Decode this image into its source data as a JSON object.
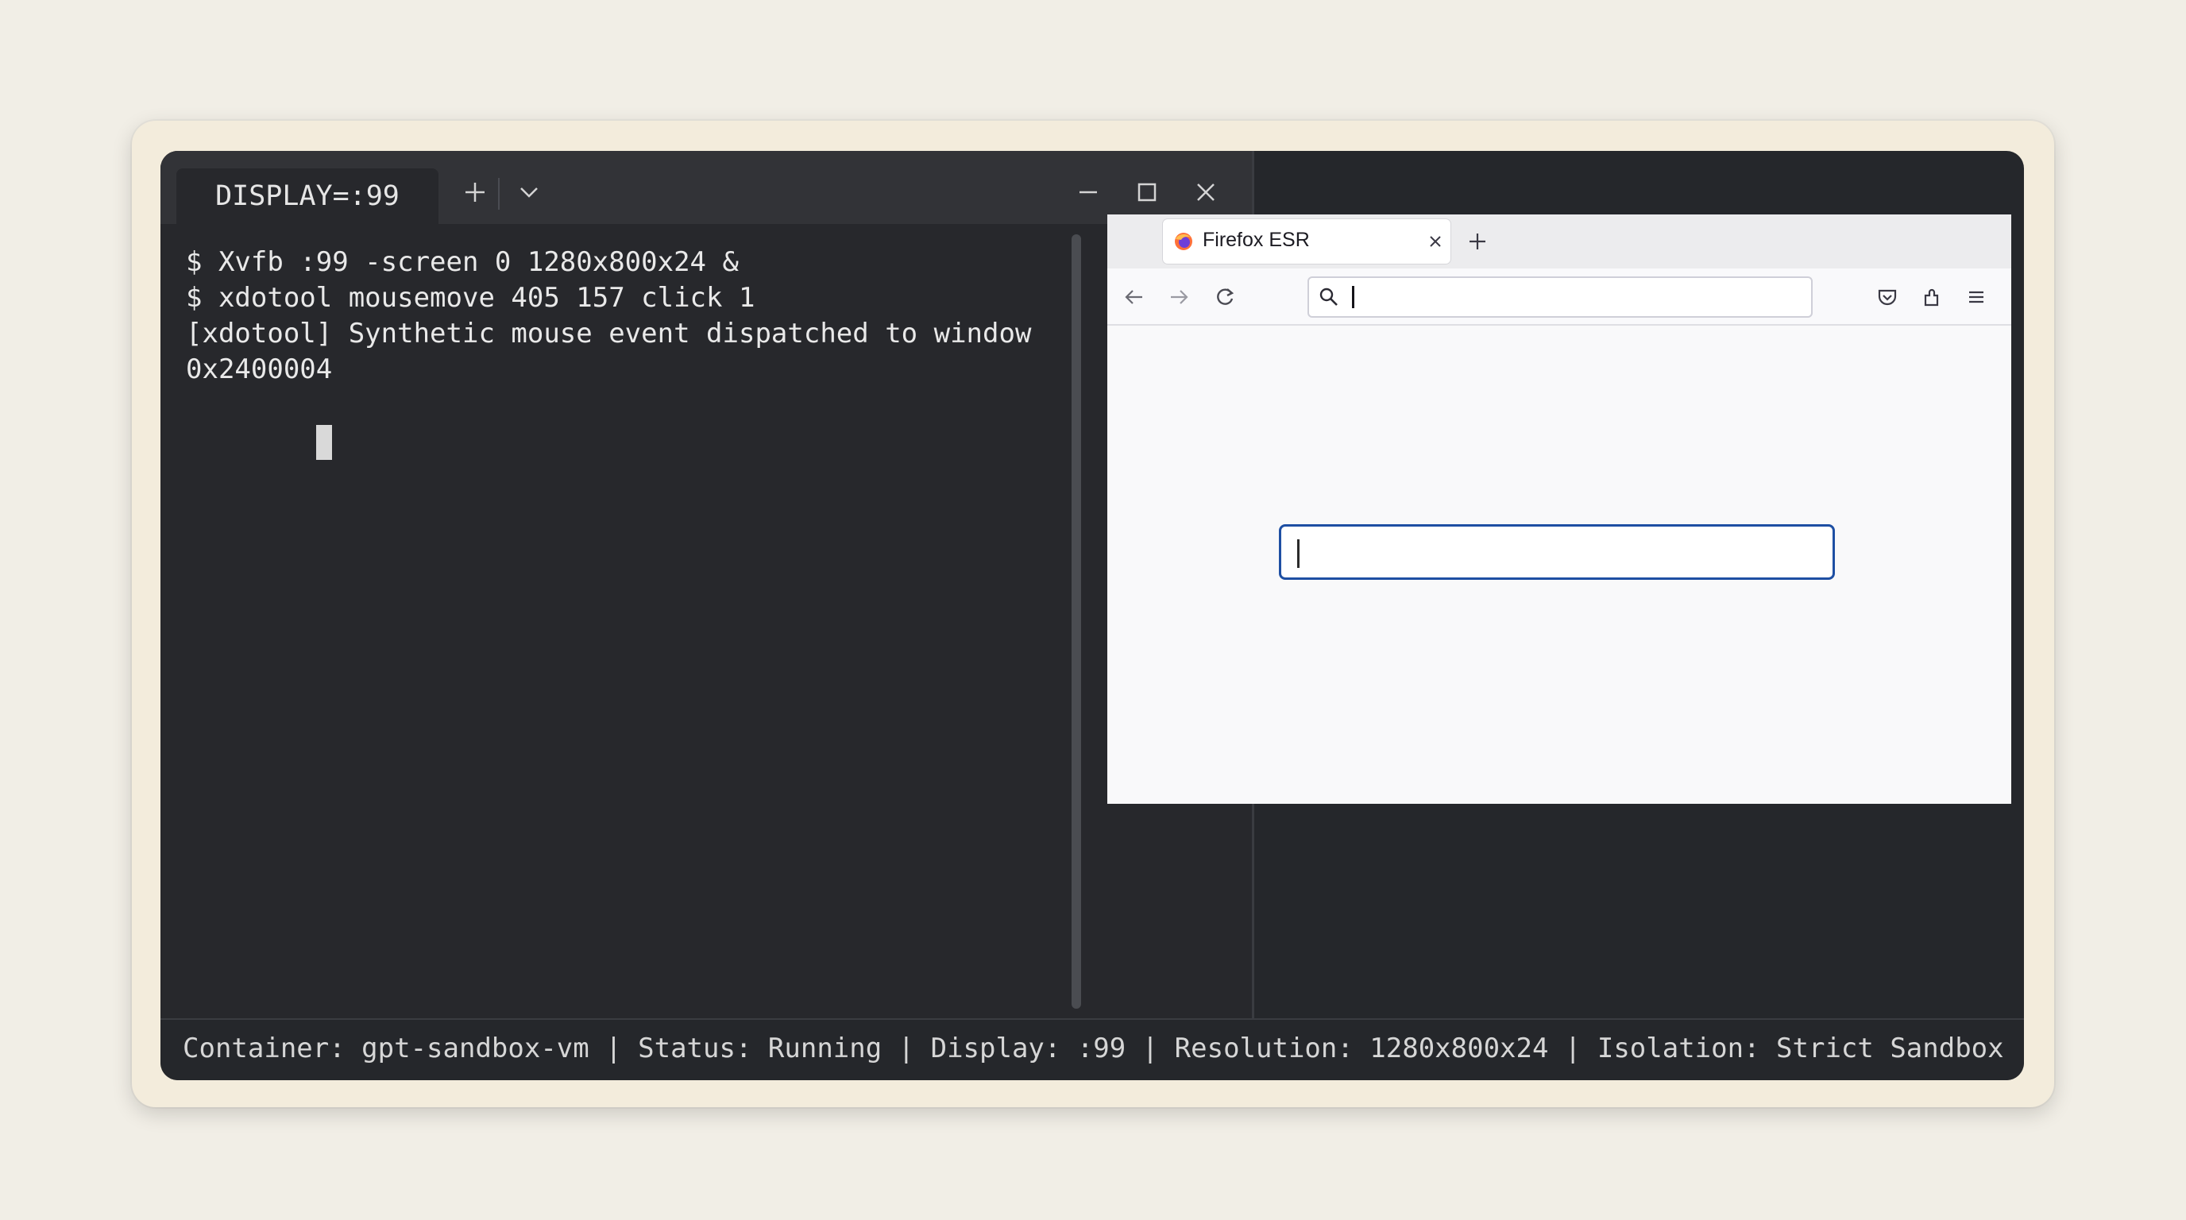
{
  "terminal": {
    "tab_title": "DISPLAY=:99",
    "lines": [
      "$ Xvfb :99 -screen 0 1280x800x24 &",
      "$ xdotool mousemove 405 157 click 1",
      "[xdotool] Synthetic mouse event dispatched to window",
      "0x2400004"
    ],
    "icons": [
      "plus-icon",
      "chevron-down-icon",
      "minimize-icon",
      "maximize-icon",
      "close-icon"
    ]
  },
  "browser": {
    "tab_title": "Firefox ESR",
    "url_value": "",
    "page_input_value": "",
    "icons": [
      "firefox-logo-icon",
      "tab-close-icon",
      "new-tab-icon",
      "back-icon",
      "forward-icon",
      "reload-icon",
      "search-icon",
      "pocket-icon",
      "extensions-icon",
      "menu-icon"
    ]
  },
  "status": {
    "text": "Container: gpt-sandbox-vm | Status: Running | Display: :99 | Resolution: 1280x800x24 | Isolation: Strict Sandbox"
  },
  "colors": {
    "background": "#f1eee6",
    "frame": "#f3ecdc",
    "screen": "#25272b",
    "terminal_bg": "#27282c",
    "page_input_border": "#1e4fa3"
  }
}
